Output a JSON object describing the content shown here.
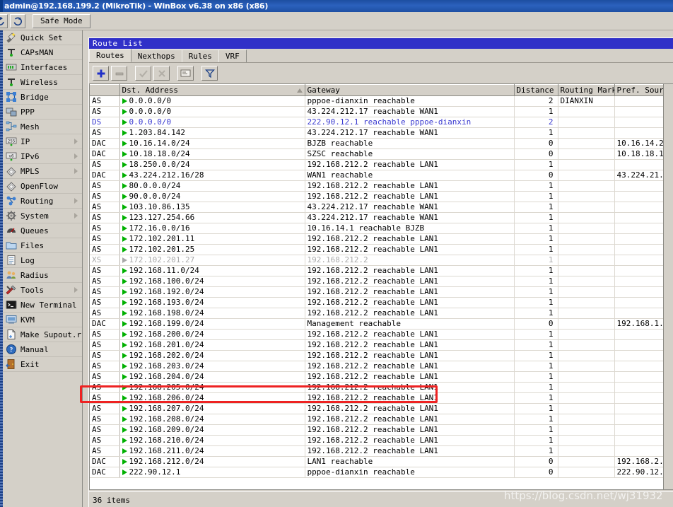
{
  "window": {
    "title": "admin@192.168.199.2 (MikroTik) - WinBox v6.38 on x86 (x86)"
  },
  "main_toolbar": {
    "refresh_icon": "refresh-icon",
    "back_icon": "back-icon",
    "safe_mode_label": "Safe Mode"
  },
  "sidebar": {
    "items": [
      {
        "label": "Quick Set",
        "icon": "quick-set-icon",
        "submenu": false
      },
      {
        "label": "CAPsMAN",
        "icon": "capsman-icon",
        "submenu": false
      },
      {
        "label": "Interfaces",
        "icon": "interfaces-icon",
        "submenu": false
      },
      {
        "label": "Wireless",
        "icon": "wireless-icon",
        "submenu": false
      },
      {
        "label": "Bridge",
        "icon": "bridge-icon",
        "submenu": false
      },
      {
        "label": "PPP",
        "icon": "ppp-icon",
        "submenu": false
      },
      {
        "label": "Mesh",
        "icon": "mesh-icon",
        "submenu": false
      },
      {
        "label": "IP",
        "icon": "ip-icon",
        "submenu": true
      },
      {
        "label": "IPv6",
        "icon": "ipv6-icon",
        "submenu": true
      },
      {
        "label": "MPLS",
        "icon": "mpls-icon",
        "submenu": true
      },
      {
        "label": "OpenFlow",
        "icon": "openflow-icon",
        "submenu": false
      },
      {
        "label": "Routing",
        "icon": "routing-icon",
        "submenu": true
      },
      {
        "label": "System",
        "icon": "system-icon",
        "submenu": true
      },
      {
        "label": "Queues",
        "icon": "queues-icon",
        "submenu": false
      },
      {
        "label": "Files",
        "icon": "files-icon",
        "submenu": false
      },
      {
        "label": "Log",
        "icon": "log-icon",
        "submenu": false
      },
      {
        "label": "Radius",
        "icon": "radius-icon",
        "submenu": false
      },
      {
        "label": "Tools",
        "icon": "tools-icon",
        "submenu": true
      },
      {
        "label": "New Terminal",
        "icon": "terminal-icon",
        "submenu": false
      },
      {
        "label": "KVM",
        "icon": "kvm-icon",
        "submenu": false
      },
      {
        "label": "Make Supout.rif",
        "icon": "supout-icon",
        "submenu": false
      },
      {
        "label": "Manual",
        "icon": "manual-icon",
        "submenu": false
      },
      {
        "label": "Exit",
        "icon": "exit-icon",
        "submenu": false
      }
    ]
  },
  "route_list": {
    "title": "Route List",
    "tabs": [
      {
        "label": "Routes",
        "active": true
      },
      {
        "label": "Nexthops",
        "active": false
      },
      {
        "label": "Rules",
        "active": false
      },
      {
        "label": "VRF",
        "active": false
      }
    ],
    "toolbar_buttons": [
      {
        "name": "add-button",
        "icon": "plus-icon",
        "enabled": true
      },
      {
        "name": "remove-button",
        "icon": "minus-icon",
        "enabled": false
      },
      {
        "name": "enable-button",
        "icon": "check-icon",
        "enabled": false
      },
      {
        "name": "disable-button",
        "icon": "cross-icon",
        "enabled": false
      },
      {
        "name": "comment-button",
        "icon": "comment-icon",
        "enabled": true
      },
      {
        "name": "filter-button",
        "icon": "filter-icon",
        "enabled": true
      }
    ],
    "columns": [
      "",
      "Dst. Address",
      "Gateway",
      "Distance",
      "Routing Mark",
      "Pref. Source"
    ],
    "sorted_column": "Dst. Address",
    "status": "36 items",
    "rows": [
      {
        "flags": "AS",
        "dst": "0.0.0.0/0",
        "gw": "pppoe-dianxin reachable",
        "dist": "2",
        "mark": "DIANXIN",
        "pref": "",
        "style": "normal"
      },
      {
        "flags": "AS",
        "dst": "0.0.0.0/0",
        "gw": "43.224.212.17 reachable WAN1",
        "dist": "1",
        "mark": "",
        "pref": "",
        "style": "normal"
      },
      {
        "flags": "DS",
        "dst": "0.0.0.0/0",
        "gw": "222.90.12.1 reachable pppoe-dianxin",
        "dist": "2",
        "mark": "",
        "pref": "",
        "style": "dyn"
      },
      {
        "flags": "AS",
        "dst": "1.203.84.142",
        "gw": "43.224.212.17 reachable WAN1",
        "dist": "1",
        "mark": "",
        "pref": "",
        "style": "normal"
      },
      {
        "flags": "DAC",
        "dst": "10.16.14.0/24",
        "gw": "BJZB reachable",
        "dist": "0",
        "mark": "",
        "pref": "10.16.14.2",
        "style": "normal"
      },
      {
        "flags": "DAC",
        "dst": "10.18.18.0/24",
        "gw": "SZSC reachable",
        "dist": "0",
        "mark": "",
        "pref": "10.18.18.1",
        "style": "normal"
      },
      {
        "flags": "AS",
        "dst": "18.250.0.0/24",
        "gw": "192.168.212.2 reachable LAN1",
        "dist": "1",
        "mark": "",
        "pref": "",
        "style": "normal"
      },
      {
        "flags": "DAC",
        "dst": "43.224.212.16/28",
        "gw": "WAN1 reachable",
        "dist": "0",
        "mark": "",
        "pref": "43.224.21...",
        "style": "normal"
      },
      {
        "flags": "AS",
        "dst": "80.0.0.0/24",
        "gw": "192.168.212.2 reachable LAN1",
        "dist": "1",
        "mark": "",
        "pref": "",
        "style": "normal"
      },
      {
        "flags": "AS",
        "dst": "90.0.0.0/24",
        "gw": "192.168.212.2 reachable LAN1",
        "dist": "1",
        "mark": "",
        "pref": "",
        "style": "normal"
      },
      {
        "flags": "AS",
        "dst": "103.10.86.135",
        "gw": "43.224.212.17 reachable WAN1",
        "dist": "1",
        "mark": "",
        "pref": "",
        "style": "normal"
      },
      {
        "flags": "AS",
        "dst": "123.127.254.66",
        "gw": "43.224.212.17 reachable WAN1",
        "dist": "1",
        "mark": "",
        "pref": "",
        "style": "normal"
      },
      {
        "flags": "AS",
        "dst": "172.16.0.0/16",
        "gw": "10.16.14.1 reachable BJZB",
        "dist": "1",
        "mark": "",
        "pref": "",
        "style": "normal"
      },
      {
        "flags": "AS",
        "dst": "172.102.201.11",
        "gw": "192.168.212.2 reachable LAN1",
        "dist": "1",
        "mark": "",
        "pref": "",
        "style": "normal"
      },
      {
        "flags": "AS",
        "dst": "172.102.201.25",
        "gw": "192.168.212.2 reachable LAN1",
        "dist": "1",
        "mark": "",
        "pref": "",
        "style": "normal"
      },
      {
        "flags": "XS",
        "dst": "172.102.201.27",
        "gw": "192.168.212.2",
        "dist": "1",
        "mark": "",
        "pref": "",
        "style": "disabled"
      },
      {
        "flags": "AS",
        "dst": "192.168.11.0/24",
        "gw": "192.168.212.2 reachable LAN1",
        "dist": "1",
        "mark": "",
        "pref": "",
        "style": "normal"
      },
      {
        "flags": "AS",
        "dst": "192.168.100.0/24",
        "gw": "192.168.212.2 reachable LAN1",
        "dist": "1",
        "mark": "",
        "pref": "",
        "style": "normal"
      },
      {
        "flags": "AS",
        "dst": "192.168.192.0/24",
        "gw": "192.168.212.2 reachable LAN1",
        "dist": "1",
        "mark": "",
        "pref": "",
        "style": "normal"
      },
      {
        "flags": "AS",
        "dst": "192.168.193.0/24",
        "gw": "192.168.212.2 reachable LAN1",
        "dist": "1",
        "mark": "",
        "pref": "",
        "style": "normal"
      },
      {
        "flags": "AS",
        "dst": "192.168.198.0/24",
        "gw": "192.168.212.2 reachable LAN1",
        "dist": "1",
        "mark": "",
        "pref": "",
        "style": "normal"
      },
      {
        "flags": "DAC",
        "dst": "192.168.199.0/24",
        "gw": "Management reachable",
        "dist": "0",
        "mark": "",
        "pref": "192.168.1...",
        "style": "normal"
      },
      {
        "flags": "AS",
        "dst": "192.168.200.0/24",
        "gw": "192.168.212.2 reachable LAN1",
        "dist": "1",
        "mark": "",
        "pref": "",
        "style": "normal"
      },
      {
        "flags": "AS",
        "dst": "192.168.201.0/24",
        "gw": "192.168.212.2 reachable LAN1",
        "dist": "1",
        "mark": "",
        "pref": "",
        "style": "normal"
      },
      {
        "flags": "AS",
        "dst": "192.168.202.0/24",
        "gw": "192.168.212.2 reachable LAN1",
        "dist": "1",
        "mark": "",
        "pref": "",
        "style": "normal"
      },
      {
        "flags": "AS",
        "dst": "192.168.203.0/24",
        "gw": "192.168.212.2 reachable LAN1",
        "dist": "1",
        "mark": "",
        "pref": "",
        "style": "normal"
      },
      {
        "flags": "AS",
        "dst": "192.168.204.0/24",
        "gw": "192.168.212.2 reachable LAN1",
        "dist": "1",
        "mark": "",
        "pref": "",
        "style": "normal"
      },
      {
        "flags": "AS",
        "dst": "192.168.205.0/24",
        "gw": "192.168.212.2 reachable LAN1",
        "dist": "1",
        "mark": "",
        "pref": "",
        "style": "normal"
      },
      {
        "flags": "AS",
        "dst": "192.168.206.0/24",
        "gw": "192.168.212.2 reachable LAN1",
        "dist": "1",
        "mark": "",
        "pref": "",
        "style": "normal"
      },
      {
        "flags": "AS",
        "dst": "192.168.207.0/24",
        "gw": "192.168.212.2 reachable LAN1",
        "dist": "1",
        "mark": "",
        "pref": "",
        "style": "normal"
      },
      {
        "flags": "AS",
        "dst": "192.168.208.0/24",
        "gw": "192.168.212.2 reachable LAN1",
        "dist": "1",
        "mark": "",
        "pref": "",
        "style": "normal"
      },
      {
        "flags": "AS",
        "dst": "192.168.209.0/24",
        "gw": "192.168.212.2 reachable LAN1",
        "dist": "1",
        "mark": "",
        "pref": "",
        "style": "normal"
      },
      {
        "flags": "AS",
        "dst": "192.168.210.0/24",
        "gw": "192.168.212.2 reachable LAN1",
        "dist": "1",
        "mark": "",
        "pref": "",
        "style": "normal"
      },
      {
        "flags": "AS",
        "dst": "192.168.211.0/24",
        "gw": "192.168.212.2 reachable LAN1",
        "dist": "1",
        "mark": "",
        "pref": "",
        "style": "normal"
      },
      {
        "flags": "DAC",
        "dst": "192.168.212.0/24",
        "gw": "LAN1 reachable",
        "dist": "0",
        "mark": "",
        "pref": "192.168.2...",
        "style": "normal"
      },
      {
        "flags": "DAC",
        "dst": "222.90.12.1",
        "gw": "pppoe-dianxin reachable",
        "dist": "0",
        "mark": "",
        "pref": "222.90.12...",
        "style": "normal"
      }
    ],
    "highlighted_row_index": 27
  },
  "annotation": {
    "type": "red-rectangle",
    "target_row": "192.168.205.0/24"
  },
  "watermark": {
    "text": "https://blog.csdn.net/wj31932"
  },
  "colors": {
    "titlebar": "#2b61bd",
    "window_title": "#3030c8",
    "chrome": "#d4d0c8",
    "dynamic_route": "#3a3ad0",
    "disabled_route": "#a8a8a8",
    "route_arrow": "#00b000",
    "annotation": "#ee2222"
  }
}
